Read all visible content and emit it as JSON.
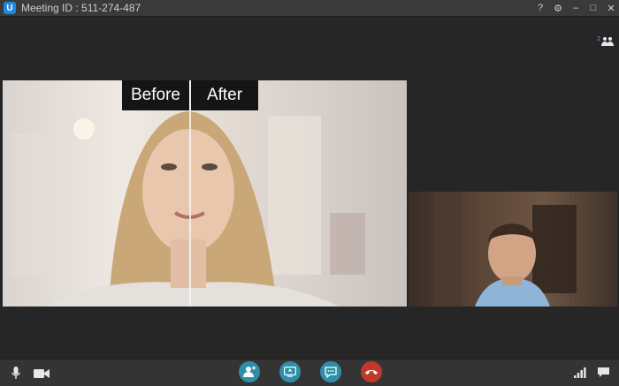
{
  "window": {
    "logo_letter": "U",
    "title": "Meeting ID : 511-274-487",
    "controls": [
      "?",
      "⚙",
      "–",
      "□",
      "✕"
    ]
  },
  "participants": {
    "count": "2",
    "icon": "people-icon"
  },
  "main_video": {
    "before_label": "Before",
    "after_label": "After"
  },
  "toolbar": {
    "left_icons": [
      "microphone-icon",
      "camera-icon"
    ],
    "center_buttons": [
      {
        "icon": "add-participant-icon",
        "color": "#2f8fa8"
      },
      {
        "icon": "share-screen-icon",
        "color": "#2f8fa8"
      },
      {
        "icon": "chat-icon",
        "color": "#2f8fa8"
      },
      {
        "icon": "end-call-icon",
        "color": "#c0392b"
      }
    ],
    "right_icons": [
      "signal-icon",
      "message-icon"
    ]
  }
}
